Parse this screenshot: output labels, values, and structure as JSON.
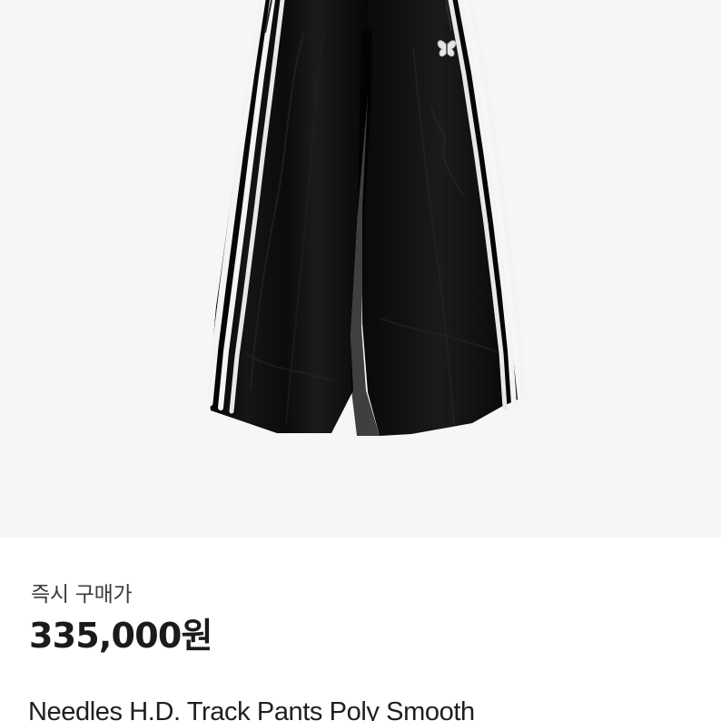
{
  "product": {
    "image_icon": "black-wide-track-pants-with-white-side-stripes-and-butterfly-logo",
    "price_label": "즉시 구매가",
    "price": "335,000원",
    "title": "Needles H.D. Track Pants Poly Smooth"
  },
  "colors": {
    "image_background": "#f6f6f6",
    "pants": "#101010",
    "stripe": "#f4f4f4",
    "text_primary": "#1f1f1f",
    "text_secondary": "#3b3b3b"
  }
}
